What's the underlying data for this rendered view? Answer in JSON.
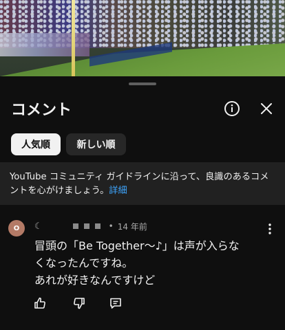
{
  "sheet": {
    "title": "コメント",
    "sort_chips": [
      {
        "label": "人気順",
        "selected": true
      },
      {
        "label": "新しい順",
        "selected": false
      }
    ],
    "notice_text": "YouTube コミュニティ ガイドラインに沿って、良識のあるコメントを心がけましょう。",
    "notice_link": "詳細"
  },
  "comment": {
    "avatar_letter": "O",
    "handle_prefix": "☾",
    "age": "14 年前",
    "lines": [
      "冒頭の「Be Together〜♪」は声が入らな",
      "くなったんですね。",
      "あれが好きなんですけど"
    ]
  },
  "icons": {
    "info": "info-circle-icon",
    "close": "close-icon",
    "more": "more-vert-icon",
    "like": "thumb-up-icon",
    "dislike": "thumb-down-icon",
    "reply": "reply-comment-icon"
  },
  "colors": {
    "background": "#0f0f0f",
    "notice_bg": "#212121",
    "link": "#3ea6ff",
    "chip_selected_bg": "#f1f1f1",
    "chip_bg": "#272727",
    "avatar": "#b37a66"
  }
}
